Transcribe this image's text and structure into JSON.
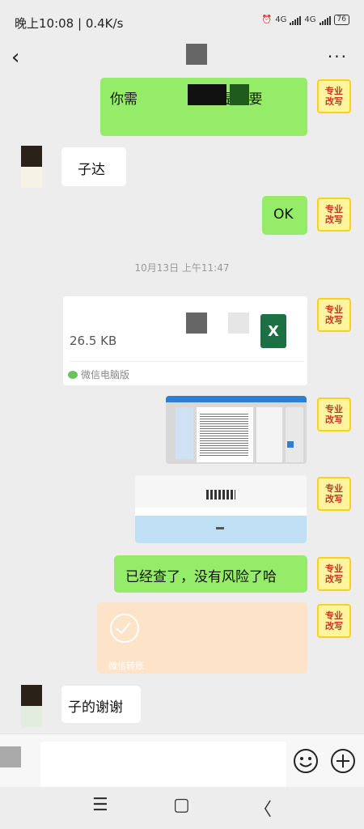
{
  "status": {
    "time_speed": "晚上10:08 | 0.4K/s",
    "net1": "4G",
    "net2": "4G",
    "battery": "76"
  },
  "nav": {
    "back_icon": "chevron-left-icon",
    "more_label": "···"
  },
  "messages": {
    "m1_text": "你需                还是需要",
    "m2_text": "子达",
    "m3_text": "OK",
    "timestamp": "10月13日 上午11:47",
    "file_size": "26.5 KB",
    "file_source": "微信电脑版",
    "file_icon_letter": "X",
    "m7_text": "已经查了，没有风险了哈",
    "transfer_label": "微信转账",
    "m9_text": "子的谢谢"
  },
  "avatar_label": "专业\n改写",
  "bottom_nav": {
    "menu": "☰",
    "home": "▢",
    "back": "〈"
  },
  "colors": {
    "bubble_green": "#95ec69",
    "transfer": "#fde3c8",
    "excel": "#1d7044"
  }
}
